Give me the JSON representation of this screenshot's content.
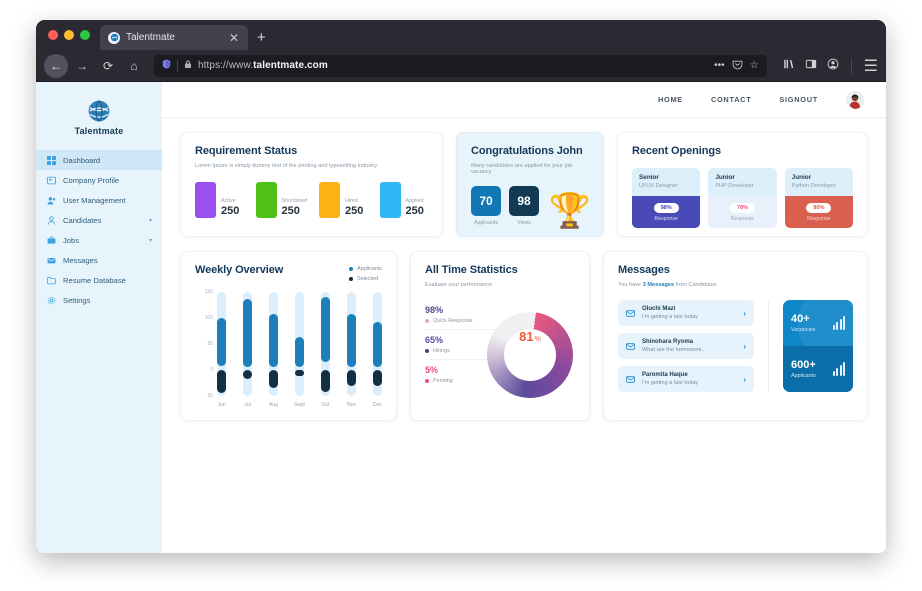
{
  "browser": {
    "tab_title": "Talentmate",
    "tab_close": "✕",
    "new_tab": "+",
    "url_prefix": "https://www.",
    "url_domain": "talentmate.com",
    "back": "←",
    "forward": "→",
    "reload": "⟳",
    "home": "⌂",
    "shield_icon": "shield-icon",
    "lock_icon": "lock-icon",
    "more_actions": "•••",
    "pocket_icon": "pocket-icon",
    "bookmark_icon": "☆",
    "library_icon": "library-icon",
    "sidebar_icon": "sidebar-icon",
    "account_icon": "account-icon",
    "menu_icon": "☰"
  },
  "sidebar": {
    "brand": "Talentmate",
    "items": [
      {
        "label": "Dashboard",
        "icon": "grid-icon",
        "active": true,
        "caret": ""
      },
      {
        "label": "Company Profile",
        "icon": "building-icon",
        "active": false,
        "caret": ""
      },
      {
        "label": "User Management",
        "icon": "users-icon",
        "active": false,
        "caret": ""
      },
      {
        "label": "Candidates",
        "icon": "person-icon",
        "active": false,
        "caret": "▾"
      },
      {
        "label": "Jobs",
        "icon": "briefcase-icon",
        "active": false,
        "caret": "▾"
      },
      {
        "label": "Messages",
        "icon": "mail-icon",
        "active": false,
        "caret": ""
      },
      {
        "label": "Resume Database",
        "icon": "folder-icon",
        "active": false,
        "caret": ""
      },
      {
        "label": "Settings",
        "icon": "gear-icon",
        "active": false,
        "caret": ""
      }
    ]
  },
  "topbar": {
    "links": [
      "HOME",
      "CONTACT",
      "SIGNOUT"
    ],
    "avatar": "user-avatar"
  },
  "requirement_status": {
    "title": "Requirement Status",
    "subtitle": "Lorem Ipsum is simply dummy text of the printing and typesetting industry.",
    "items": [
      {
        "label": "Active",
        "value": "250",
        "color": "#9a4ff0"
      },
      {
        "label": "Shortlisted",
        "value": "250",
        "color": "#4fc117"
      },
      {
        "label": "Hired",
        "value": "250",
        "color": "#fbb215"
      },
      {
        "label": "Applied",
        "value": "250",
        "color": "#2fb8f5"
      }
    ]
  },
  "congratulations": {
    "title": "Congratulations John",
    "subtitle": "Many candidates are applied for your job vacancy",
    "stats": [
      {
        "value": "70",
        "label": "Applicants",
        "style": "blue"
      },
      {
        "value": "98",
        "label": "Views",
        "style": "navy"
      }
    ],
    "trophy_icon": "🏆"
  },
  "recent_openings": {
    "title": "Recent Openings",
    "items": [
      {
        "level": "Senior",
        "role": "UI/UX Designer",
        "percent": "98%",
        "response": "Response",
        "bg": "#4a49b8",
        "pct_color": "#4a49b8",
        "resp_color": "#dcdcf4"
      },
      {
        "level": "Junior",
        "role": "PHP Developer",
        "percent": "78%",
        "response": "Response",
        "bg": "#e8f0fc",
        "pct_color": "#e6577a",
        "resp_color": "#9aa6c0"
      },
      {
        "level": "Junior",
        "role": "Python Developer",
        "percent": "80%",
        "response": "Response",
        "bg": "#d9604f",
        "pct_color": "#d9604f",
        "resp_color": "#f6d8d3"
      }
    ]
  },
  "chart_data": [
    {
      "type": "bar",
      "title": "Weekly Overview",
      "xlabel": "",
      "ylabel": "",
      "ylim": [
        -50,
        150
      ],
      "yticks": [
        "150",
        "100",
        "50",
        "0",
        "50"
      ],
      "grid": false,
      "legend_position": "top-right",
      "categories": [
        "Jun",
        "Jul",
        "Aug",
        "Sept",
        "Oct",
        "Nov",
        "Dec"
      ],
      "series": [
        {
          "name": "Applicants",
          "color": "#1a7fba",
          "values": [
            100,
            137,
            107,
            63,
            140,
            107,
            92
          ],
          "baselines": [
            8,
            5,
            5,
            5,
            15,
            5,
            5
          ]
        },
        {
          "name": "Selected",
          "color": "#112f45",
          "values": [
            -45,
            -18,
            -35,
            -12,
            -42,
            -30,
            -30
          ]
        },
        {
          "name": "Track",
          "color": "#dceefb",
          "values": [
            150,
            150,
            150,
            150,
            150,
            150,
            150
          ],
          "baselines": [
            -50,
            -50,
            -50,
            -50,
            -50,
            -50,
            -50
          ]
        }
      ]
    },
    {
      "type": "pie",
      "title": "All Time Statistics",
      "subtitle": "Evaluate your performance",
      "center_value": "81",
      "center_symbol": "%",
      "labels": [
        "Quick Response",
        "Hirings",
        "Pending"
      ],
      "values": [
        98,
        65,
        5
      ],
      "value_labels": [
        "98%",
        "65%",
        "5%"
      ],
      "colors": [
        "#f2a0b5",
        "#5b4b9c",
        "#ec4d77"
      ]
    }
  ],
  "weekly_overview": {
    "title": "Weekly Overview",
    "legend": [
      {
        "label": "Applicants",
        "color": "#1a7fba"
      },
      {
        "label": "Selected",
        "color": "#112f45"
      }
    ]
  },
  "all_time_statistics": {
    "title": "All Time Statistics",
    "subtitle": "Evaluate your performance",
    "rows": [
      {
        "percent": "98%",
        "label": "Quick Response",
        "color": "#f2a0b5",
        "pct_color": "#4a4a8c"
      },
      {
        "percent": "65%",
        "label": "Hirings",
        "color": "#4a3f8c",
        "pct_color": "#5b4b9c"
      },
      {
        "percent": "5%",
        "label": "Pending",
        "color": "#ec4d77",
        "pct_color": "#ec4d77"
      }
    ],
    "center_value": "81",
    "center_symbol": "%"
  },
  "messages": {
    "title": "Messages",
    "subtitle_pre": "You have ",
    "subtitle_strong": "3 Messages",
    "subtitle_post": " from Candidates",
    "items": [
      {
        "name": "Oluchi Mazi",
        "preview": "I'm getting a late today",
        "icon": "mail-icon",
        "arrow": "›"
      },
      {
        "name": "Shinohara Ryoma",
        "preview": "What are the homework...",
        "icon": "mail-icon",
        "arrow": "›"
      },
      {
        "name": "Paromita Haque",
        "preview": "I'm getting a late today",
        "icon": "mail-icon",
        "arrow": "›"
      }
    ],
    "vacancy_card": {
      "top_value": "40+",
      "top_label": "Vacancies",
      "bottom_value": "600+",
      "bottom_label": "Applicants"
    }
  }
}
